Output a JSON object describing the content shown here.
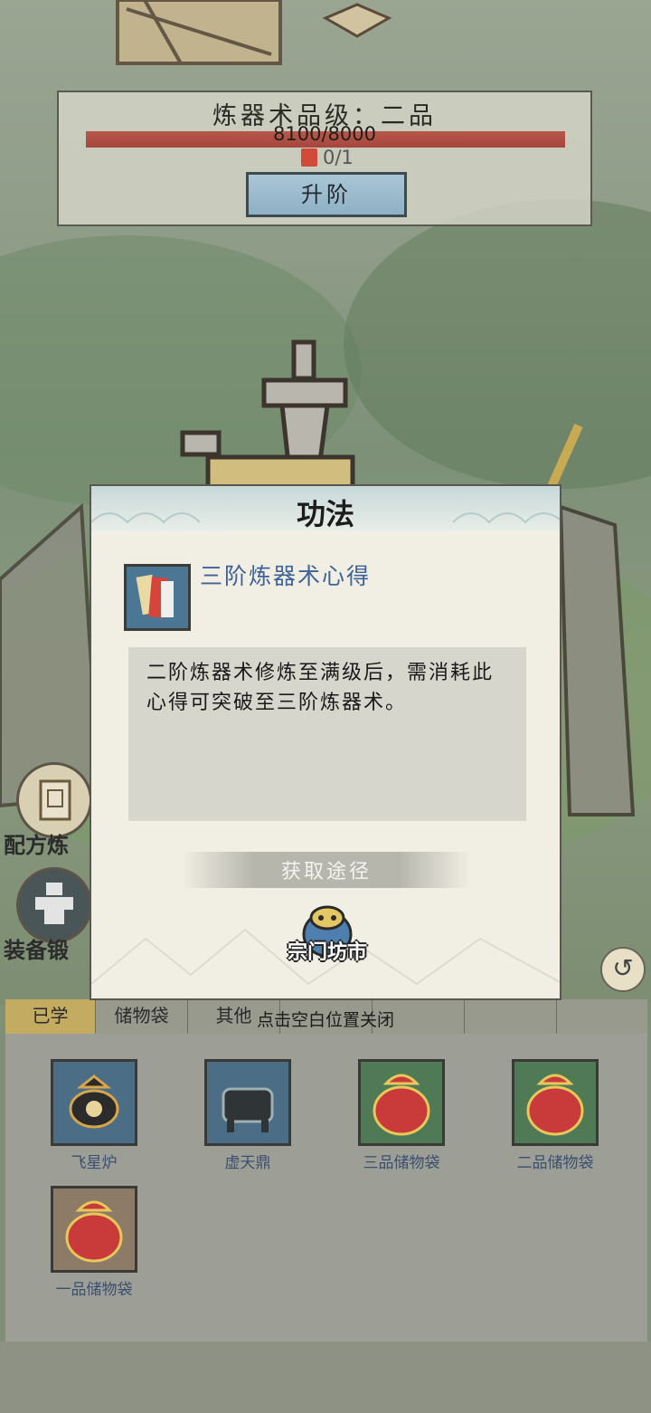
{
  "level_panel": {
    "title": "炼器术品级：二品",
    "progress_text": "8100/8000",
    "progress_fraction": 1.0,
    "item_count": "0/1",
    "upgrade_label": "升阶"
  },
  "side_buttons": {
    "recipe_label": "配方炼",
    "equip_label": "装备锻"
  },
  "tabs": [
    "已学",
    "储物袋",
    "其他",
    "",
    "",
    ""
  ],
  "inventory": [
    {
      "label": "飞星炉",
      "icon": "furnace-icon",
      "bg": "blue"
    },
    {
      "label": "虚天鼎",
      "icon": "cauldron-icon",
      "bg": "blue"
    },
    {
      "label": "三品储物袋",
      "icon": "pouch-icon",
      "bg": "green"
    },
    {
      "label": "二品储物袋",
      "icon": "pouch-icon",
      "bg": "green"
    },
    {
      "label": "一品储物袋",
      "icon": "pouch-icon",
      "bg": "tan"
    }
  ],
  "dialog": {
    "title": "功法",
    "item_name": "三阶炼器术心得",
    "description": "二阶炼器术修炼至满级后，需消耗此心得可突破至三阶炼器术。",
    "obtain_label": "获取途径",
    "source_label": "宗门坊市"
  },
  "close_hint": "点击空白位置关闭",
  "colors": {
    "accent_blue": "#3f6297",
    "progress_red": "#a5473e",
    "tab_active": "#c3ab62"
  }
}
